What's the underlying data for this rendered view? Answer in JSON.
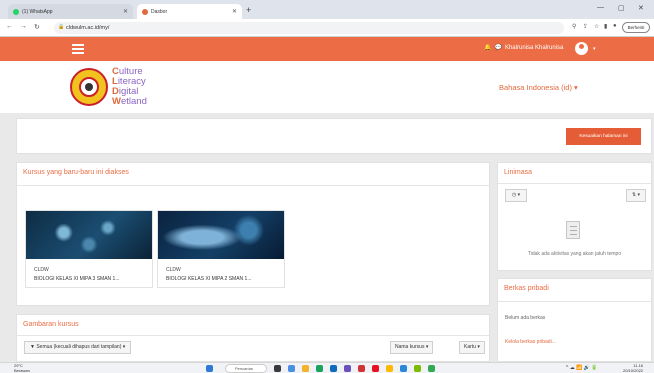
{
  "browser": {
    "tabs": [
      {
        "label": "(1) WhatsApp",
        "favicon_color": "#25d366"
      },
      {
        "label": "Dasbor",
        "favicon_color": "#e16a3d"
      }
    ],
    "new_tab": "+",
    "url": "cldwulm.ac.id/my/",
    "profile_label": "Berhenti"
  },
  "navbar": {
    "user_name": "Khalrunisa Khalrunisa"
  },
  "header": {
    "logo_lines": [
      {
        "first": "C",
        "rest": "ulture"
      },
      {
        "first": "L",
        "rest": "iteracy"
      },
      {
        "first": "D",
        "rest": "igital"
      },
      {
        "first": "W",
        "rest": "etland"
      }
    ],
    "language": "Bahasa Indonesia (id) ▾"
  },
  "actionbar": {
    "reset_label": "Kesuaikan halaman ini"
  },
  "recent": {
    "title": "Kursus yang baru-baru ini diakses",
    "courses": [
      {
        "category": "CLDW",
        "name": "BIOLOGI KELAS XI MIPA 3 SMAN 1..."
      },
      {
        "category": "CLDW",
        "name": "BIOLOGI KELAS XI MIPA 2 SMAN 1..."
      }
    ]
  },
  "overview": {
    "title": "Gambaran kursus",
    "filter_label": "▼ Semua (kecuali dihapus dari tampilan) ▾",
    "sort_label": "Nama kursus ▾",
    "view_label": "Kartu ▾"
  },
  "timeline": {
    "title": "Linimasa",
    "filter_btn": "◷ ▾",
    "sort_btn": "⇅ ▾",
    "empty_text": "Tidak ada aktivitas yang akan jatuh tempo"
  },
  "files": {
    "title": "Berkas pribadi",
    "none_text": "Belum ada berkas",
    "manage_link": "Kelola berkas pribadi..."
  },
  "taskbar": {
    "weather_temp": "29°C",
    "weather_desc": "Berawan",
    "search_label": "Pencarian",
    "time": "11.16",
    "date": "20/10/2022"
  }
}
